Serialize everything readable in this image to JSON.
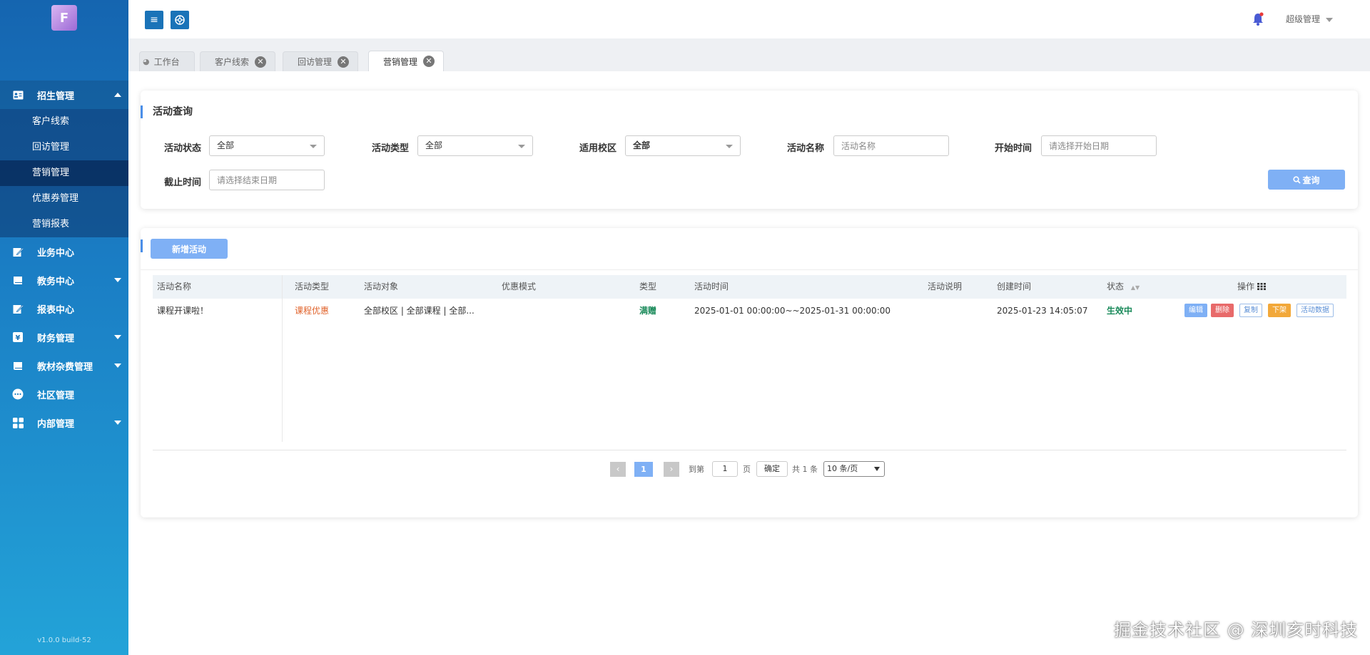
{
  "sidebar": {
    "logo_text": "F",
    "menu": [
      {
        "label": "招生管理",
        "icon": "id-card-icon",
        "open": true,
        "children": [
          "客户线索",
          "回访管理",
          "营销管理",
          "优惠券管理",
          "营销报表"
        ]
      },
      {
        "label": "业务中心",
        "icon": "edit-icon"
      },
      {
        "label": "教务中心",
        "icon": "book-icon"
      },
      {
        "label": "报表中心",
        "icon": "report-icon"
      },
      {
        "label": "财务管理",
        "icon": "yuan-icon"
      },
      {
        "label": "教材杂费管理",
        "icon": "book-icon"
      },
      {
        "label": "社区管理",
        "icon": "chat-icon"
      },
      {
        "label": "内部管理",
        "icon": "grid-icon"
      }
    ],
    "version": "v1.0.0 build-52"
  },
  "header": {
    "user": "超级管理"
  },
  "tabs": [
    {
      "label": "工作台"
    },
    {
      "label": "客户线索"
    },
    {
      "label": "回访管理"
    },
    {
      "label": "营销管理",
      "active": true
    }
  ],
  "query": {
    "title": "活动查询",
    "labels": {
      "status": "活动状态",
      "type": "活动类型",
      "campus": "适用校区",
      "name": "活动名称",
      "start": "开始时间",
      "end": "截止时间"
    },
    "values": {
      "status": "全部",
      "type": "全部",
      "campus": "全部"
    },
    "placeholders": {
      "name": "活动名称",
      "start": "请选择开始日期",
      "end": "请选择结束日期"
    },
    "button": "查询"
  },
  "list": {
    "add_button": "新增活动",
    "columns": [
      "活动名称",
      "活动类型",
      "活动对象",
      "优惠模式",
      "类型",
      "活动时间",
      "活动说明",
      "创建时间",
      "状态",
      "操作"
    ],
    "rows": [
      {
        "name": "课程开课啦！",
        "activity_type": "课程优惠",
        "target": "全部校区 | 全部课程 | 全部...",
        "mode": "",
        "type": "满赠",
        "time": "2025-01-01 00:00:00~~2025-01-31 00:00:00",
        "desc": "",
        "created": "2025-01-23 14:05:07",
        "status": "生效中",
        "ops": [
          "编辑",
          "删除",
          "复制",
          "下架",
          "活动数据"
        ]
      }
    ],
    "colors": {
      "activity_type": "#e0622a",
      "type": "#1a8a5a",
      "status": "#1a8a5a"
    }
  },
  "pagination": {
    "current": "1",
    "goto_label": "到第",
    "goto_value": "1",
    "page_unit": "页",
    "confirm": "确定",
    "total": "共 1 条",
    "page_size": "10 条/页"
  },
  "watermark": "掘金技术社区 @ 深圳亥时科技"
}
